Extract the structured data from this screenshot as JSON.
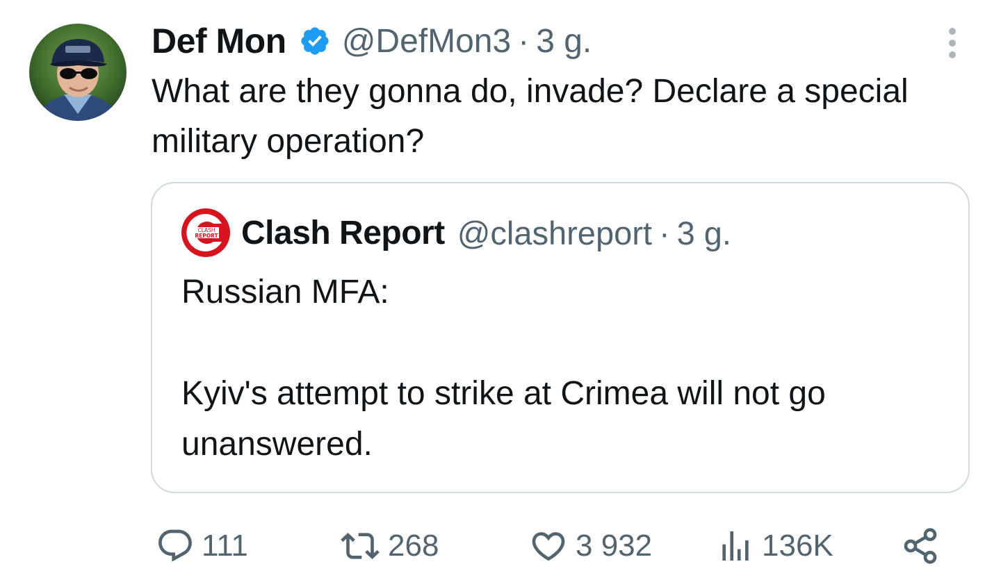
{
  "tweet": {
    "author": {
      "display_name": "Def Mon",
      "handle": "@DefMon3",
      "separator": "·",
      "time": "3 g.",
      "verified": true,
      "avatar_icon": "user-avatar-photo"
    },
    "text": "What are they gonna do, invade? Declare a special military operation?",
    "more_icon": "more-vertical-icon"
  },
  "quote": {
    "author": {
      "display_name": "Clash Report",
      "handle": "@clashreport",
      "separator": "·",
      "time": "3 g.",
      "avatar_icon": "clash-report-logo",
      "logo_text_1": "CLASH",
      "logo_text_2": "REPORT"
    },
    "lines": [
      "Russian MFA:",
      "Kyiv's attempt to strike at Crimea will not go unanswered."
    ]
  },
  "actions": {
    "replies": "111",
    "reposts": "268",
    "likes": "3 932",
    "views": "136K"
  },
  "colors": {
    "text_primary": "#0f1419",
    "text_secondary": "#536471",
    "verified_blue": "#1d9bf0",
    "border": "#cfd9de",
    "clash_red": "#d7141e"
  }
}
